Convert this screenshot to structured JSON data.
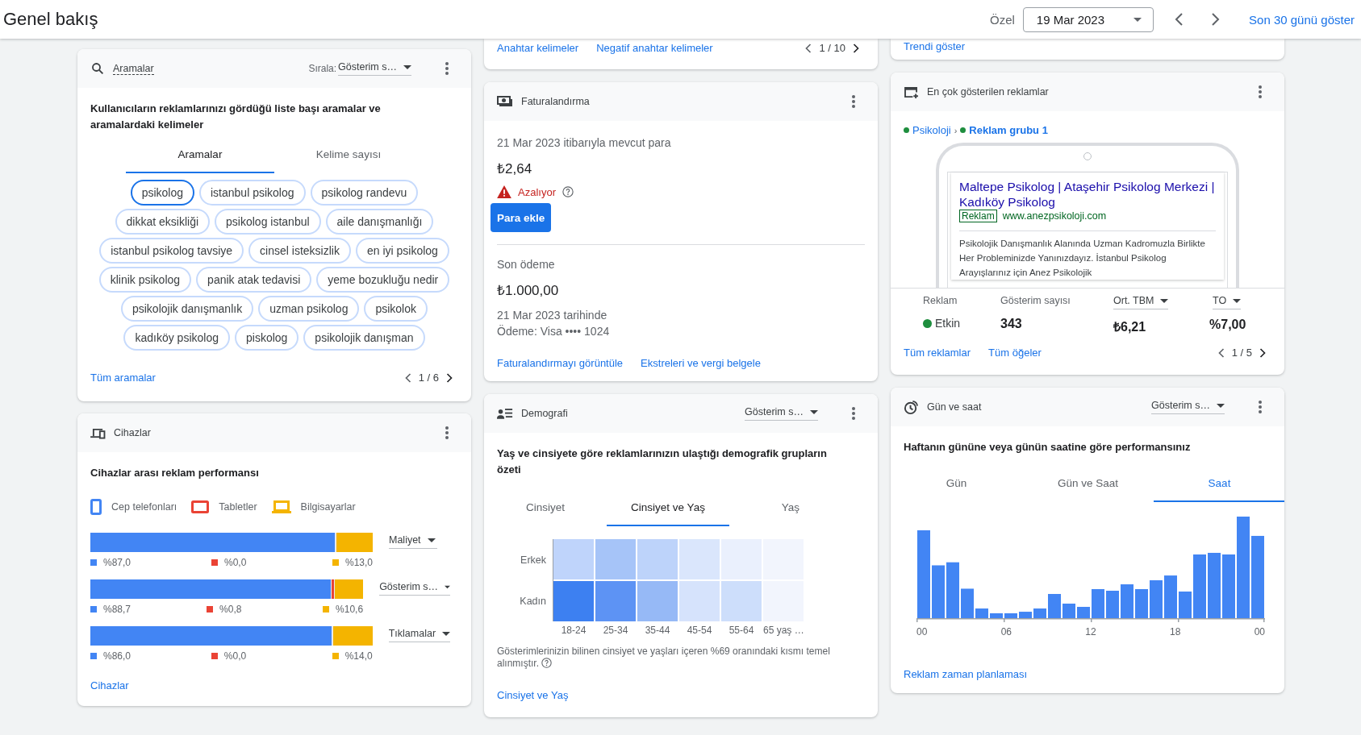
{
  "header": {
    "title": "Genel bakış",
    "range_label": "Özel",
    "date": "19 Mar 2023",
    "show_link": "Son 30 günü göster"
  },
  "keywords_tail": {
    "links": [
      "Anahtar kelimeler",
      "Negatif anahtar kelimeler"
    ],
    "pager": "1 / 10"
  },
  "trend_tail": {
    "link": "Trendi göster"
  },
  "searches": {
    "title": "Aramalar",
    "sort_label": "Sırala:",
    "sort_value": "Gösterim s…",
    "description": "Kullanıcıların reklamlarınızı gördüğü liste başı aramalar ve aramalardaki kelimeler",
    "tabs": [
      {
        "label": "Aramalar",
        "selected": true
      },
      {
        "label": "Kelime sayısı",
        "selected": false
      }
    ],
    "chips": [
      {
        "label": "psikolog",
        "selected": true
      },
      {
        "label": "istanbul psikolog",
        "selected": false
      },
      {
        "label": "psikolog randevu",
        "selected": false
      },
      {
        "label": "dikkat eksikliği",
        "selected": false
      },
      {
        "label": "psikolog istanbul",
        "selected": false
      },
      {
        "label": "aile danışmanlığı",
        "selected": false
      },
      {
        "label": "istanbul psikolog tavsiye",
        "selected": false
      },
      {
        "label": "cinsel isteksizlik",
        "selected": false
      },
      {
        "label": "en iyi psikolog",
        "selected": false
      },
      {
        "label": "klinik psikolog",
        "selected": false
      },
      {
        "label": "panik atak tedavisi",
        "selected": false
      },
      {
        "label": "yeme bozukluğu nedir",
        "selected": false
      },
      {
        "label": "psikolojik danışmanlık",
        "selected": false
      },
      {
        "label": "uzman psikolog",
        "selected": false
      },
      {
        "label": "psikolok",
        "selected": false
      },
      {
        "label": "kadıköy psikolog",
        "selected": false
      },
      {
        "label": "piskolog",
        "selected": false
      },
      {
        "label": "psikolojik danışman",
        "selected": false
      }
    ],
    "footer_link": "Tüm aramalar",
    "pager": "1 / 6"
  },
  "devices": {
    "title": "Cihazlar",
    "description": "Cihazlar arası reklam performansı",
    "legend": [
      {
        "kind": "phone",
        "label": "Cep telefonları",
        "color": "#4285f4"
      },
      {
        "kind": "tablet",
        "label": "Tabletler",
        "color": "#ea4335"
      },
      {
        "kind": "computer",
        "label": "Bilgisayarlar",
        "color": "#f4b400"
      }
    ],
    "rows": [
      {
        "metric": "Maliyet",
        "segments": [
          {
            "level": 0.87,
            "value": "%87,0"
          },
          {
            "level": 0.0,
            "value": "%0,0"
          },
          {
            "level": 0.13,
            "value": "%13,0"
          }
        ]
      },
      {
        "metric": "Gösterim s…",
        "segments": [
          {
            "level": 0.887,
            "value": "%88,7"
          },
          {
            "level": 0.008,
            "value": "%0,8"
          },
          {
            "level": 0.106,
            "value": "%10,6"
          }
        ]
      },
      {
        "metric": "Tıklamalar",
        "segments": [
          {
            "level": 0.86,
            "value": "%86,0"
          },
          {
            "level": 0.0,
            "value": "%0,0"
          },
          {
            "level": 0.14,
            "value": "%14,0"
          }
        ]
      }
    ],
    "footer_link": "Cihazlar"
  },
  "billing": {
    "title": "Faturalandırma",
    "balance_label": "21 Mar 2023 itibarıyla mevcut para",
    "balance": "₺2,64",
    "warning": "Azalıyor",
    "add_button": "Para ekle",
    "last_payment_label": "Son ödeme",
    "last_payment": "₺1.000,00",
    "payment_date": "21 Mar 2023 tarihinde",
    "payment_method": "Ödeme: Visa •••• 1024",
    "links": [
      "Faturalandırmayı görüntüle",
      "Ekstreleri ve vergi belgele"
    ]
  },
  "demographics": {
    "title": "Demografi",
    "metric": "Gösterim s…",
    "description": "Yaş ve cinsiyete göre reklamlarınızın ulaştığı demografik grupların özeti",
    "tabs": [
      {
        "label": "Cinsiyet",
        "selected": false
      },
      {
        "label": "Cinsiyet ve Yaş",
        "selected": true
      },
      {
        "label": "Yaş",
        "selected": false
      }
    ],
    "rows": [
      "Erkek",
      "Kadın"
    ],
    "columns": [
      "18-24",
      "25-34",
      "35-44",
      "45-54",
      "55-64",
      "65 yaş …"
    ],
    "note": "Gösterimlerinizin bilinen cinsiyet ve yaşları içeren %69 oranındaki kısmı temel alınmıştır.",
    "footer_link": "Cinsiyet ve Yaş"
  },
  "top_ads": {
    "title": "En çok gösterilen reklamlar",
    "breadcrumb": [
      "Psikoloji",
      "Reklam grubu 1"
    ],
    "breadcrumb_separator": "›",
    "ad": {
      "headline": "Maltepe Psikolog | Ataşehir Psikolog Merkezi | Kadıköy Psikolog",
      "badge": "Reklam",
      "url": "www.anezpsikoloji.com",
      "description": "Psikolojik Danışmanlık Alanında Uzman Kadromuzla Birlikte Her Probleminizde Yanınızdayız. İstanbul Psikolog Arayışlarınız için Anez Psikolojik"
    },
    "stats": [
      {
        "label": "Reklam",
        "value": "Etkin",
        "kind": "status"
      },
      {
        "label": "Gösterim sayısı",
        "value": "343",
        "kind": "plain"
      },
      {
        "label": "Ort. TBM",
        "value": "₺6,21",
        "kind": "sortable"
      },
      {
        "label": "TO",
        "value": "%7,00",
        "kind": "sortable"
      }
    ],
    "links": [
      "Tüm reklamlar",
      "Tüm öğeler"
    ],
    "pager": "1 / 5"
  },
  "day_time": {
    "title": "Gün ve saat",
    "metric": "Gösterim s…",
    "description": "Haftanın gününe veya günün saatine göre performansınız",
    "tabs": [
      {
        "label": "Gün",
        "selected": false
      },
      {
        "label": "Gün ve Saat",
        "selected": false
      },
      {
        "label": "Saat",
        "selected": true
      }
    ],
    "x_ticks": [
      "00",
      "06",
      "12",
      "18",
      "00"
    ],
    "footer_link": "Reklam zaman planlaması"
  }
}
